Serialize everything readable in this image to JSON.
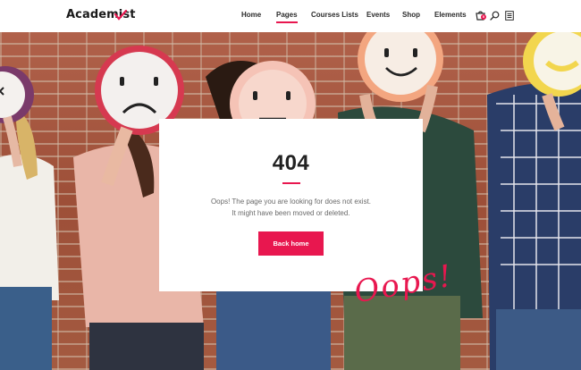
{
  "header": {
    "logo": "Academist",
    "nav": [
      "Home",
      "Pages",
      "Courses Lists",
      "Events",
      "Shop",
      "Elements"
    ],
    "active_nav": "Pages",
    "cart_count": "0"
  },
  "error": {
    "code": "404",
    "message_line1": "Oops! The page you are looking for does not exist.",
    "message_line2": "It might have been moved or deleted.",
    "button_label": "Back home"
  },
  "decor_text": "Oops!",
  "colors": {
    "accent": "#e8174f",
    "text_dark": "#222222",
    "brick": "#a65a3f"
  },
  "icons": [
    "cart-icon",
    "search-icon",
    "menu-icon"
  ]
}
